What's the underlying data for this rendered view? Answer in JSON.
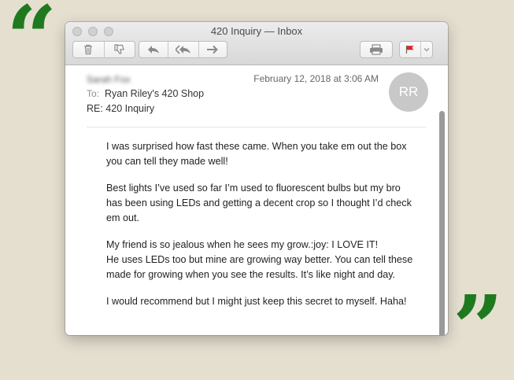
{
  "window": {
    "title": "420 Inquiry — Inbox"
  },
  "toolbar": {
    "delete_icon": "trash-icon",
    "junk_icon": "thumbs-down-icon",
    "reply_icon": "reply-icon",
    "reply_all_icon": "reply-all-icon",
    "forward_icon": "forward-icon",
    "print_icon": "printer-icon",
    "flag_icon": "flag-icon",
    "flag_color": "#e02424",
    "flag_menu_icon": "chevron-down-icon"
  },
  "message": {
    "from": "Sarah Fox",
    "date": "February 12, 2018 at 3:06 AM",
    "to_label": "To:",
    "to": "Ryan Riley's 420 Shop",
    "subject": "RE: 420 Inquiry",
    "avatar_initials": "RR",
    "paragraphs": [
      "I was surprised how fast these came. When you take em out the box\nyou can tell they made well!",
      "Best lights I’ve used so far I’m used to fluorescent bulbs but my bro\nhas been using LEDs and getting a decent crop so I thought I’d check\nem out.",
      "My friend is so jealous when he sees my grow.:joy: I LOVE IT!\nHe uses LEDs too but mine are growing way better. You can tell these\nmade for growing when you see the results. It’s like night and day.",
      "I would recommend but I might just keep this secret to myself. Haha!"
    ]
  },
  "decor": {
    "open_quote": "“",
    "close_quote": "”",
    "quote_color": "#1f7a1f",
    "background": "#e5dfd0"
  }
}
